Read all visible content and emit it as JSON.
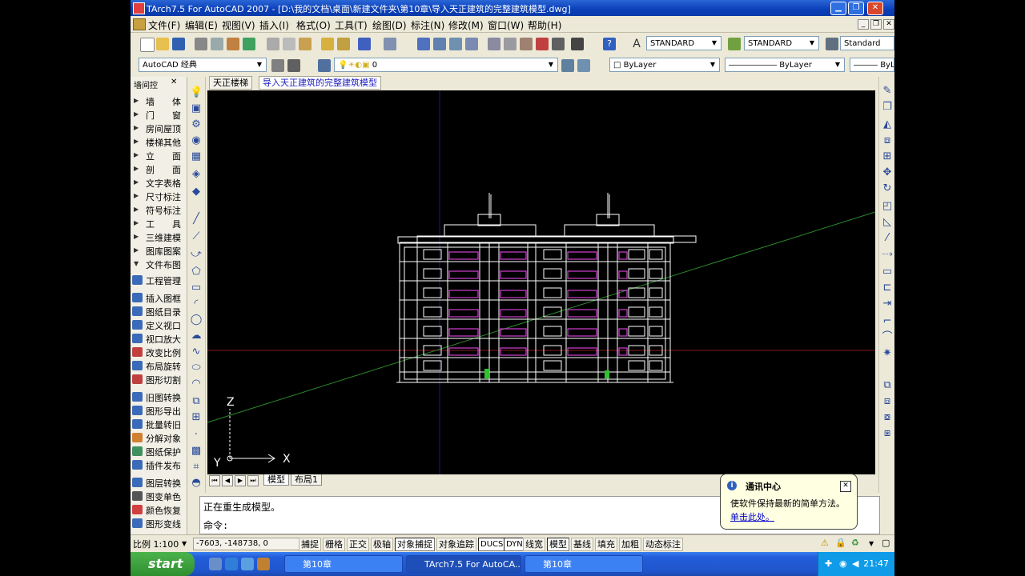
{
  "window": {
    "title": "TArch7.5 For AutoCAD 2007 - [D:\\我的文档\\桌面\\新建文件夹\\第10章\\导入天正建筑的完整建筑模型.dwg]"
  },
  "menu": [
    "文件(F)",
    "编辑(E)",
    "视图(V)",
    "插入(I)",
    "格式(O)",
    "工具(T)",
    "绘图(D)",
    "标注(N)",
    "修改(M)",
    "窗口(W)",
    "帮助(H)"
  ],
  "toolbar": {
    "text_style": "STANDARD",
    "dim_style": "STANDARD",
    "table_style": "Standard",
    "workspace": "AutoCAD 经典",
    "layer": "0",
    "color": "ByLayer",
    "linetype": "ByLayer",
    "lineweight": "ByL"
  },
  "left_panel": {
    "header": "墙间控",
    "tree_items": [
      "墙　　体",
      "门　　窗",
      "房间屋顶",
      "楼梯其他",
      "立　　面",
      "剖　　面",
      "文字表格",
      "尺寸标注",
      "符号标注",
      "工　　具",
      "三维建模",
      "图库图案",
      "文件布图"
    ],
    "tool_items": [
      "工程管理",
      "插入图框",
      "图纸目录",
      "定义视口",
      "视口放大",
      "改变比例",
      "布局旋转",
      "图形切割",
      "旧图转换",
      "图形导出",
      "批量转旧",
      "分解对象",
      "图纸保护",
      "插件发布",
      "图层转换",
      "图变单色",
      "颜色恢复",
      "图形变线"
    ]
  },
  "tabs": {
    "tianzheng": "天正楼梯",
    "drawing": "导入天正建筑的完整建筑模型"
  },
  "layout_tabs": [
    "模型",
    "布局1"
  ],
  "command": {
    "line1": "正在重生成模型。",
    "line2": "命令:"
  },
  "balloon": {
    "title": "通讯中心",
    "message": "使软件保持最新的简单方法。",
    "link": "单击此处。"
  },
  "ucs": {
    "x": "X",
    "y": "Y",
    "z": "Z"
  },
  "status": {
    "scale": "比例 1:100",
    "coords": "-7603, -148738, 0",
    "buttons": [
      "捕捉",
      "栅格",
      "正交",
      "极轴",
      "对象捕捉",
      "对象追踪",
      "DUCS",
      "DYN",
      "线宽",
      "模型",
      "基线",
      "填充",
      "加粗",
      "动态标注"
    ]
  },
  "taskbar": {
    "start": "start",
    "tasks": [
      "第10章",
      "TArch7.5 For AutoCA...",
      "第10章"
    ],
    "clock": "21:47"
  },
  "colors": {
    "titlebar": "#0a3fb8",
    "canvas_bg": "#000000",
    "building_lines": "#ffffff",
    "magenta_hatch": "#d040d0",
    "green_axis": "#3a9a3a",
    "red_axis": "#a02020",
    "blue_axis": "#2020a0",
    "balloon_bg": "#ffffe1"
  }
}
